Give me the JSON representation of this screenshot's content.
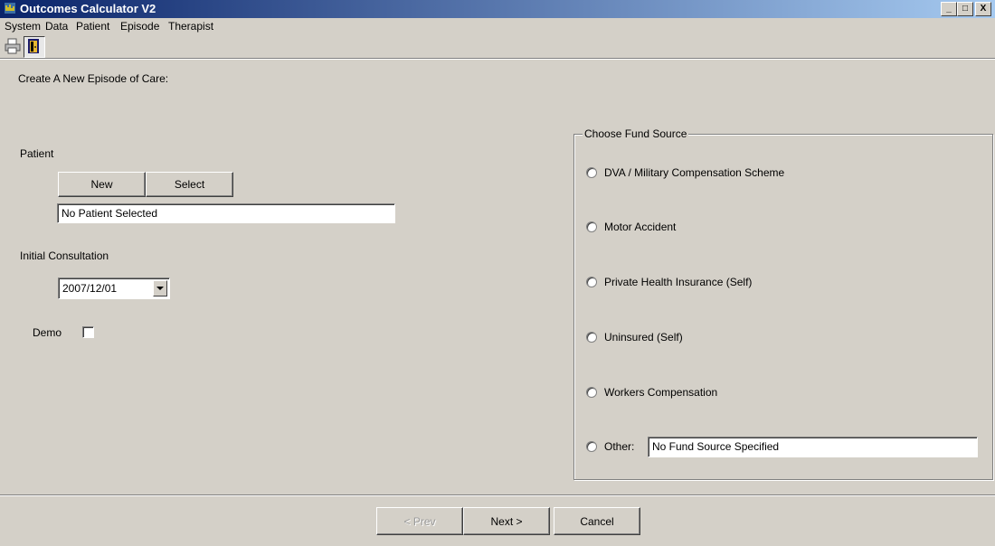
{
  "window": {
    "title": "Outcomes Calculator V2",
    "minimize": "_",
    "maximize": "□",
    "close": "X"
  },
  "menu": [
    "System",
    "Data",
    "Patient",
    "Episode",
    "Therapist"
  ],
  "toolbar": {
    "icons": [
      "printer-icon",
      "door-exit-icon"
    ]
  },
  "form": {
    "heading": "Create A New Episode of Care:",
    "patient": {
      "label": "Patient",
      "new_button": "New",
      "select_button": "Select",
      "selected": "No Patient Selected"
    },
    "consultation": {
      "label": "Initial Consultation",
      "date": "2007/12/01"
    },
    "demo": {
      "label": "Demo",
      "checked": false
    }
  },
  "fund": {
    "title": "Choose Fund Source",
    "options": [
      "DVA / Military Compensation Scheme",
      "Motor Accident",
      "Private Health Insurance (Self)",
      "Uninsured (Self)",
      "Workers Compensation"
    ],
    "other_label": "Other:",
    "other_value": "No Fund Source Specified"
  },
  "nav": {
    "prev": "< Prev",
    "next": "Next >",
    "cancel": "Cancel"
  }
}
